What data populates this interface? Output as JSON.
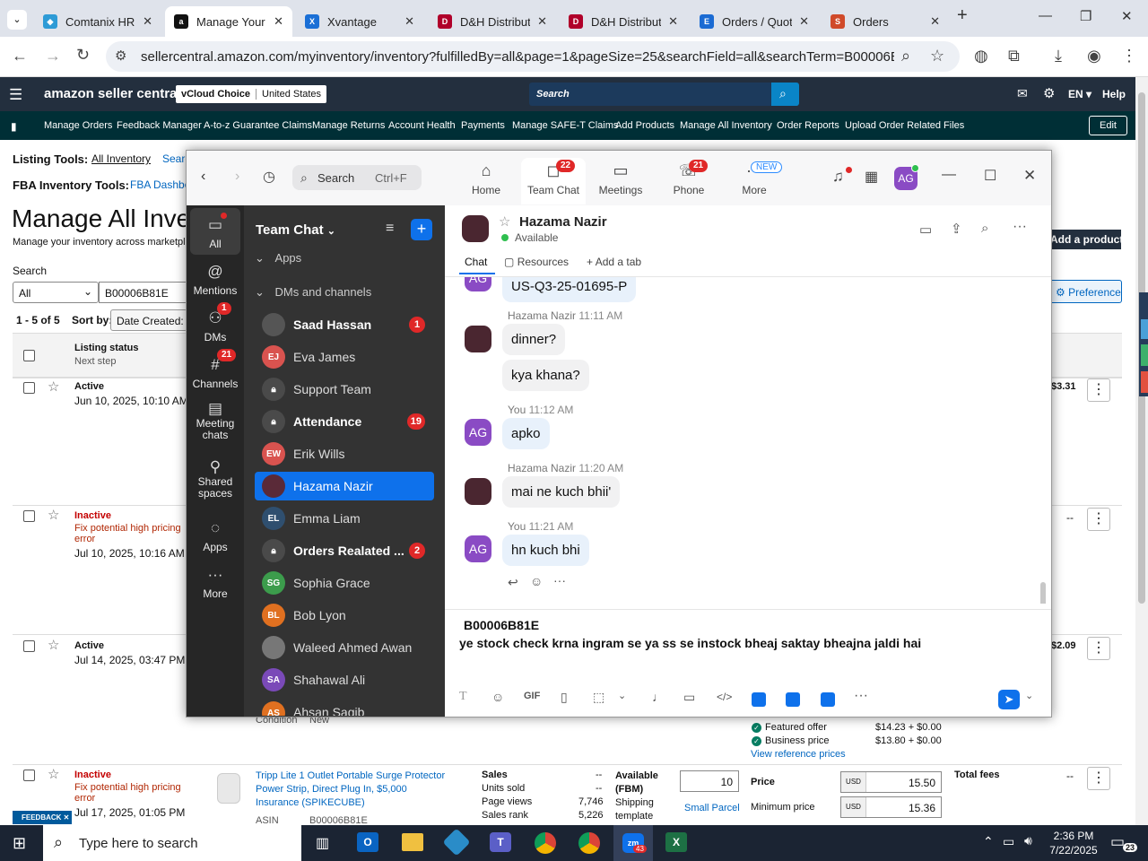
{
  "browser": {
    "tabs": [
      {
        "label": "Comtanix HRM",
        "color": "#2e9bd6"
      },
      {
        "label": "Manage Your",
        "color": "#111"
      },
      {
        "label": "Xvantage",
        "color": "#1a6fd6"
      },
      {
        "label": "D&H Distribut",
        "color": "#b0002a"
      },
      {
        "label": "D&H Distribut",
        "color": "#b0002a"
      },
      {
        "label": "Orders / Quot",
        "color": "#1b6bd3"
      },
      {
        "label": "Orders",
        "color": "#d04a2a"
      }
    ],
    "url": "sellercentral.amazon.com/myinventory/inventory?fulfilledBy=all&page=1&pageSize=25&searchField=all&searchTerm=B00006B81E&..."
  },
  "amazon": {
    "logo": "amazon seller central",
    "account": "vCloud Choice",
    "marketplace": "United States",
    "search_placeholder": "Search",
    "lang": "EN",
    "help": "Help",
    "nav": [
      "Manage Orders",
      "Feedback Manager",
      "A-to-z Guarantee Claims",
      "Manage Returns",
      "Account Health",
      "Payments",
      "Manage SAFE-T Claims",
      "Add Products",
      "Manage All Inventory",
      "Order Reports",
      "Upload Order Related Files"
    ],
    "edit": "Edit",
    "listing_tools_label": "Listing Tools:",
    "listing_tools_links": [
      "All Inventory",
      "Searc"
    ],
    "fba_tools_label": "FBA Inventory Tools:",
    "fba_tools_link": "FBA Dashboa",
    "page_title": "Manage All Inve",
    "page_subtitle": "Manage your inventory across marketpla",
    "search_label": "Search",
    "search_scope": "All",
    "search_value": "B00006B81E",
    "results": "1 - 5 of 5",
    "sort_label": "Sort by:",
    "sort_value": "Date Created: Ne",
    "add_product": "Add a product",
    "preferences": "Preferences",
    "col_status": "Listing status",
    "col_next": "Next step",
    "rows": [
      {
        "status": "Active",
        "date": "Jun 10, 2025, 10:10 AM",
        "price": "$3.31"
      },
      {
        "status": "Inactive",
        "note": "Fix potential high pricing error",
        "date": "Jul 10, 2025, 10:16 AM",
        "price": "--"
      },
      {
        "status": "Active",
        "date": "Jul 14, 2025, 03:47 PM",
        "price": "$2.09"
      },
      {
        "status": "Inactive",
        "note": "Fix potential high pricing error",
        "date": "Jul 17, 2025, 01:05 PM",
        "price": "--"
      }
    ],
    "condition": "Condition",
    "condition_value": "New",
    "featured_offer": "Featured offer",
    "featured_price": "$14.23 + $0.00",
    "business_price": "Business price",
    "business_value": "$13.80 + $0.00",
    "view_ref": "View reference prices",
    "product_title": "Tripp Lite 1 Outlet Portable Surge Protector Power Strip, Direct Plug In, $5,000 Insurance (SPIKECUBE)",
    "asin_label": "ASIN",
    "asin_value": "B00006B81E",
    "sales": "Sales",
    "units_sold": "Units sold",
    "units_sold_val": "--",
    "page_views": "Page views",
    "page_views_val": "7,746",
    "sales_rank": "Sales rank",
    "sales_rank_val": "5,226",
    "sales_dash": "--",
    "available": "Available (FBM)",
    "shipping": "Shipping template",
    "qty": "10",
    "small_parcel": "Small Parcel",
    "price_label": "Price",
    "min_price_label": "Minimum price",
    "usd": "USD",
    "price_val": "15.50",
    "min_price_val": "15.36",
    "total_fees": "Total fees",
    "fees_dash": "--",
    "feedback": "FEEDBACK"
  },
  "zoom": {
    "search_label": "Search",
    "search_shortcut": "Ctrl+F",
    "nav": [
      {
        "label": "Home",
        "icon": "home-icon"
      },
      {
        "label": "Team Chat",
        "badge": "22",
        "icon": "chat-icon"
      },
      {
        "label": "Meetings",
        "icon": "video-icon"
      },
      {
        "label": "Phone",
        "badge": "21",
        "icon": "phone-icon"
      },
      {
        "label": "More",
        "badge": "NEW",
        "icon": "more-icon"
      }
    ],
    "user_initials": "AG",
    "rail": [
      {
        "label": "All"
      },
      {
        "label": "Mentions"
      },
      {
        "label": "DMs",
        "badge": "1"
      },
      {
        "label": "Channels",
        "badge": "21"
      },
      {
        "label": "Meeting chats"
      },
      {
        "label": "Shared spaces"
      },
      {
        "label": "Apps"
      },
      {
        "label": "More"
      }
    ],
    "list_title": "Team Chat",
    "apps_section": "Apps",
    "dms_section": "DMs and channels",
    "contacts": [
      {
        "name": "Saad Hassan",
        "badge": "1",
        "bold": true
      },
      {
        "name": "Eva James",
        "initials": "EJ"
      },
      {
        "name": "Support Team"
      },
      {
        "name": "Attendance",
        "badge": "19",
        "bold": true
      },
      {
        "name": "Erik Wills",
        "initials": "EW"
      },
      {
        "name": "Hazama Nazir"
      },
      {
        "name": "Emma Liam",
        "initials": "EL"
      },
      {
        "name": "Orders Realated ...",
        "badge": "2",
        "bold": true
      },
      {
        "name": "Sophia Grace",
        "initials": "SG"
      },
      {
        "name": "Bob Lyon",
        "initials": "BL"
      },
      {
        "name": "Waleed Ahmed Awan"
      },
      {
        "name": "Shahawal Ali",
        "initials": "SA"
      },
      {
        "name": "Ahsan Saqib",
        "initials": "AS"
      }
    ],
    "chat_name": "Hazama Nazir",
    "chat_status": "Available",
    "chat_tab": "Chat",
    "resources_tab": "Resources",
    "add_tab": "Add a tab",
    "messages": [
      {
        "kind": "me_cont",
        "text": "US-Q3-25-01695-P"
      },
      {
        "kind": "them",
        "sender": "Hazama Nazir",
        "time": "11:11 AM",
        "text": "dinner?"
      },
      {
        "kind": "them_cont",
        "text": "kya khana?"
      },
      {
        "kind": "me",
        "sender": "You",
        "time": "11:12 AM",
        "text": "apko"
      },
      {
        "kind": "them",
        "sender": "Hazama Nazir",
        "time": "11:20 AM",
        "text": "mai ne kuch bhii'"
      },
      {
        "kind": "me",
        "sender": "You",
        "time": "11:21 AM",
        "text": "hn kuch bhi"
      }
    ],
    "compose_line1": "B00006B81E",
    "compose_line2": "ye stock check krna ingram se ya ss se instock bheaj saktay bheajna jaldi hai"
  },
  "taskbar": {
    "search_placeholder": "Type here to search",
    "time": "2:36 PM",
    "date": "7/22/2025",
    "notif": "23",
    "zoom_badge": "43"
  }
}
